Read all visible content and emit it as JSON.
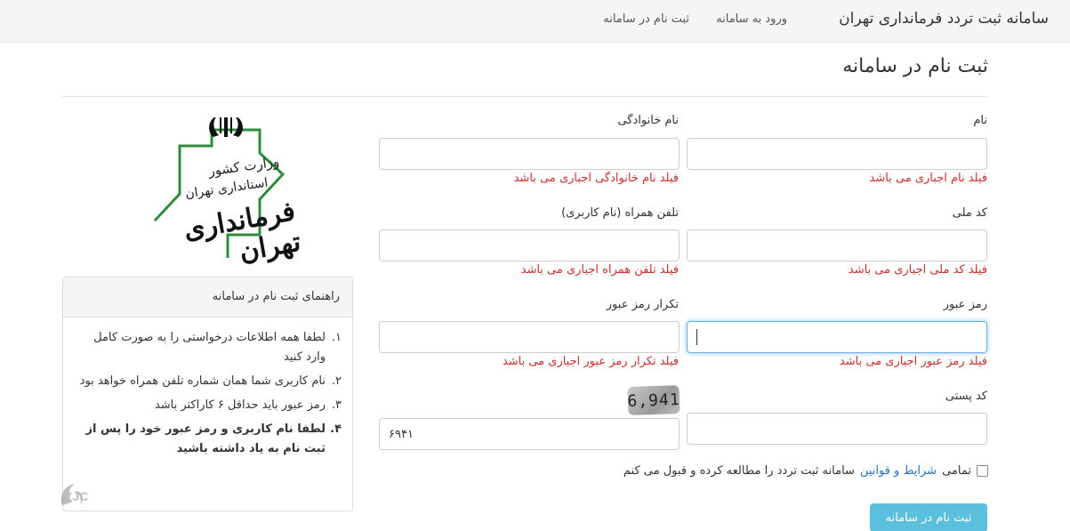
{
  "navbar": {
    "brand": "سامانه ثبت تردد فرمانداری تهران",
    "login_link": "ورود به سامانه",
    "register_link": "ثبت نام در سامانه"
  },
  "page_title": "ثبت نام در سامانه",
  "form": {
    "first_name": {
      "label": "نام",
      "value": "",
      "error": "فیلد نام اجباری می باشد"
    },
    "last_name": {
      "label": "نام خانوادگی",
      "value": "",
      "error": "فیلد نام خانوادگی اجباری می باشد"
    },
    "national_code": {
      "label": "کد ملی",
      "value": "",
      "error": "فیلد کد ملی اجباری می باشد"
    },
    "mobile": {
      "label": "تلفن همراه (نام کاربری)",
      "value": "",
      "error": "فیلد تلفن همراه اجباری می باشد"
    },
    "password": {
      "label": "رمز عبور",
      "value": "",
      "error": "فیلد رمز عبور اجباری می باشد"
    },
    "password_repeat": {
      "label": "تکرار رمز عبور",
      "value": "",
      "error": "فیلد تکرار رمز عبور اجباری می باشد"
    },
    "postal_code": {
      "label": "کد پستی",
      "value": ""
    },
    "captcha": {
      "image_text": "6,941",
      "value": "۶۹۴۱"
    },
    "terms": {
      "prefix": "تمامی",
      "link": "شرایط و قوانین",
      "suffix": "سامانه ثبت تردد را مطالعه کرده و قبول می کنم",
      "checked": false
    },
    "submit_label": "ثبت نام در سامانه"
  },
  "logo": {
    "line1": "وزارت کشور",
    "line2": "استانداری تهران",
    "line3": "فرمانداری تهران"
  },
  "guide": {
    "title": "راهنمای ثبت نام در سامانه",
    "items": [
      {
        "num": "۱.",
        "text": "لطفا همه اطلاعات درخواستی را به صورت کامل وارد کنید"
      },
      {
        "num": "۲.",
        "text": "نام کاربری شما همان شماره تلفن همراه خواهد بود"
      },
      {
        "num": "۳.",
        "text": "رمز عبور باید حداقل ۶ کاراکتر باشد"
      },
      {
        "num": "۴.",
        "text": "لطفا نام کاربری و رمز عبور خود را پس از ثبت نام به یاد داشته باشید"
      }
    ]
  },
  "watermark": {
    "text": "YJC"
  },
  "colors": {
    "error": "#c9302c",
    "submit": "#5bc0de",
    "link": "#2a6db0",
    "emblem_green": "#2e8b3e",
    "focus": "#66afe9"
  }
}
